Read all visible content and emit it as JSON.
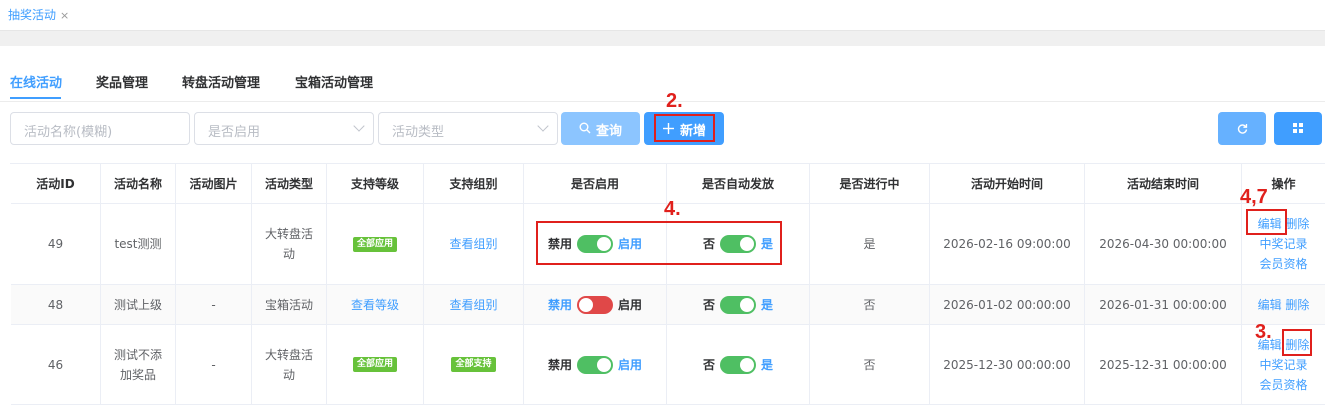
{
  "page_tab": {
    "label": "抽奖活动",
    "close": "×"
  },
  "subtabs": [
    "在线活动",
    "奖品管理",
    "转盘活动管理",
    "宝箱活动管理"
  ],
  "filters": {
    "name_placeholder": "活动名称(模糊)",
    "enabled_placeholder": "是否启用",
    "type_placeholder": "活动类型"
  },
  "buttons": {
    "query": "查询",
    "add": "新增"
  },
  "table": {
    "headers": [
      "活动ID",
      "活动名称",
      "活动图片",
      "活动类型",
      "支持等级",
      "支持组别",
      "是否启用",
      "是否自动发放",
      "是否进行中",
      "活动开始时间",
      "活动结束时间",
      "操作"
    ],
    "rows": [
      {
        "id": "49",
        "name": "test测测",
        "image": "",
        "type": "大转盘活动",
        "level_badge": "全部应用",
        "level_link": "",
        "group_link": "查看组别",
        "group_badge": "",
        "enable_left": "禁用",
        "enable_right": "启用",
        "enable_on": true,
        "auto_left": "否",
        "auto_right": "是",
        "auto_on": true,
        "ongoing": "是",
        "start": "2026-02-16 09:00:00",
        "end": "2026-04-30 00:00:00",
        "ops": [
          "编辑",
          "删除",
          "中奖记录",
          "会员资格"
        ]
      },
      {
        "id": "48",
        "name": "测试上级",
        "image": "-",
        "type": "宝箱活动",
        "level_badge": "",
        "level_link": "查看等级",
        "group_link": "查看组别",
        "group_badge": "",
        "enable_left": "禁用",
        "enable_right": "启用",
        "enable_on": false,
        "auto_left": "否",
        "auto_right": "是",
        "auto_on": true,
        "ongoing": "否",
        "start": "2026-01-02 00:00:00",
        "end": "2026-01-31 00:00:00",
        "ops": [
          "编辑",
          "删除"
        ]
      },
      {
        "id": "46",
        "name": "测试不添加奖品",
        "image": "-",
        "type": "大转盘活动",
        "level_badge": "全部应用",
        "level_link": "",
        "group_link": "",
        "group_badge": "全部支持",
        "enable_left": "禁用",
        "enable_right": "启用",
        "enable_on": true,
        "auto_left": "否",
        "auto_right": "是",
        "auto_on": true,
        "ongoing": "否",
        "start": "2025-12-30 00:00:00",
        "end": "2025-12-31 00:00:00",
        "ops": [
          "编辑",
          "删除",
          "中奖记录",
          "会员资格"
        ]
      }
    ]
  },
  "annotations": {
    "add": "2.",
    "switches": "4.",
    "edit": "4,7",
    "delete": "3."
  },
  "colors": {
    "accent": "#409eff",
    "success": "#67c23a",
    "danger": "#e04848",
    "annotation": "#e0201c"
  }
}
